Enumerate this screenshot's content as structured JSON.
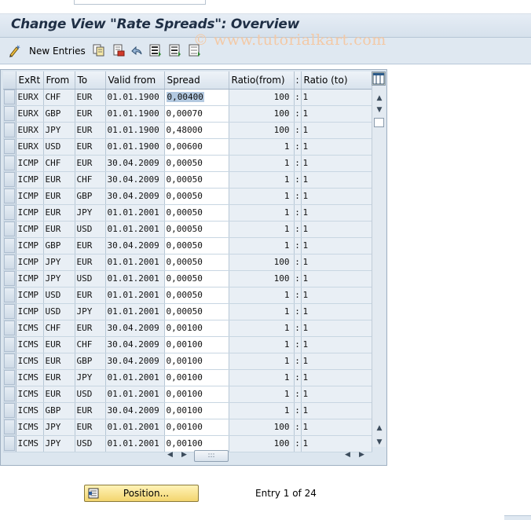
{
  "window": {
    "title": "Change View \"Rate Spreads\": Overview",
    "watermark": "© www.tutorialkart.com"
  },
  "toolbar": {
    "new_entries_label": "New Entries",
    "icons": [
      "new-entries-icon",
      "copy-icon",
      "delete-icon",
      "undo-icon",
      "select-all-icon",
      "select-block-icon",
      "deselect-all-icon"
    ]
  },
  "table": {
    "columns": [
      "ExRt",
      "From",
      "To",
      "Valid from",
      "Spread",
      "Ratio(from)",
      ":",
      "Ratio (to)"
    ],
    "rows": [
      [
        "EURX",
        "CHF",
        "EUR",
        "01.01.1900",
        "0,00400",
        "100",
        ":",
        "1"
      ],
      [
        "EURX",
        "GBP",
        "EUR",
        "01.01.1900",
        "0,00070",
        "100",
        ":",
        "1"
      ],
      [
        "EURX",
        "JPY",
        "EUR",
        "01.01.1900",
        "0,48000",
        "100",
        ":",
        "1"
      ],
      [
        "EURX",
        "USD",
        "EUR",
        "01.01.1900",
        "0,00600",
        "1",
        ":",
        "1"
      ],
      [
        "ICMP",
        "CHF",
        "EUR",
        "30.04.2009",
        "0,00050",
        "1",
        ":",
        "1"
      ],
      [
        "ICMP",
        "EUR",
        "CHF",
        "30.04.2009",
        "0,00050",
        "1",
        ":",
        "1"
      ],
      [
        "ICMP",
        "EUR",
        "GBP",
        "30.04.2009",
        "0,00050",
        "1",
        ":",
        "1"
      ],
      [
        "ICMP",
        "EUR",
        "JPY",
        "01.01.2001",
        "0,00050",
        "1",
        ":",
        "1"
      ],
      [
        "ICMP",
        "EUR",
        "USD",
        "01.01.2001",
        "0,00050",
        "1",
        ":",
        "1"
      ],
      [
        "ICMP",
        "GBP",
        "EUR",
        "30.04.2009",
        "0,00050",
        "1",
        ":",
        "1"
      ],
      [
        "ICMP",
        "JPY",
        "EUR",
        "01.01.2001",
        "0,00050",
        "100",
        ":",
        "1"
      ],
      [
        "ICMP",
        "JPY",
        "USD",
        "01.01.2001",
        "0,00050",
        "100",
        ":",
        "1"
      ],
      [
        "ICMP",
        "USD",
        "EUR",
        "01.01.2001",
        "0,00050",
        "1",
        ":",
        "1"
      ],
      [
        "ICMP",
        "USD",
        "JPY",
        "01.01.2001",
        "0,00050",
        "1",
        ":",
        "1"
      ],
      [
        "ICMS",
        "CHF",
        "EUR",
        "30.04.2009",
        "0,00100",
        "1",
        ":",
        "1"
      ],
      [
        "ICMS",
        "EUR",
        "CHF",
        "30.04.2009",
        "0,00100",
        "1",
        ":",
        "1"
      ],
      [
        "ICMS",
        "EUR",
        "GBP",
        "30.04.2009",
        "0,00100",
        "1",
        ":",
        "1"
      ],
      [
        "ICMS",
        "EUR",
        "JPY",
        "01.01.2001",
        "0,00100",
        "1",
        ":",
        "1"
      ],
      [
        "ICMS",
        "EUR",
        "USD",
        "01.01.2001",
        "0,00100",
        "1",
        ":",
        "1"
      ],
      [
        "ICMS",
        "GBP",
        "EUR",
        "30.04.2009",
        "0,00100",
        "1",
        ":",
        "1"
      ],
      [
        "ICMS",
        "JPY",
        "EUR",
        "01.01.2001",
        "0,00100",
        "100",
        ":",
        "1"
      ],
      [
        "ICMS",
        "JPY",
        "USD",
        "01.01.2001",
        "0,00100",
        "100",
        ":",
        "1"
      ]
    ]
  },
  "footer": {
    "position_label": "Position...",
    "entry_text": "Entry 1 of 24"
  }
}
